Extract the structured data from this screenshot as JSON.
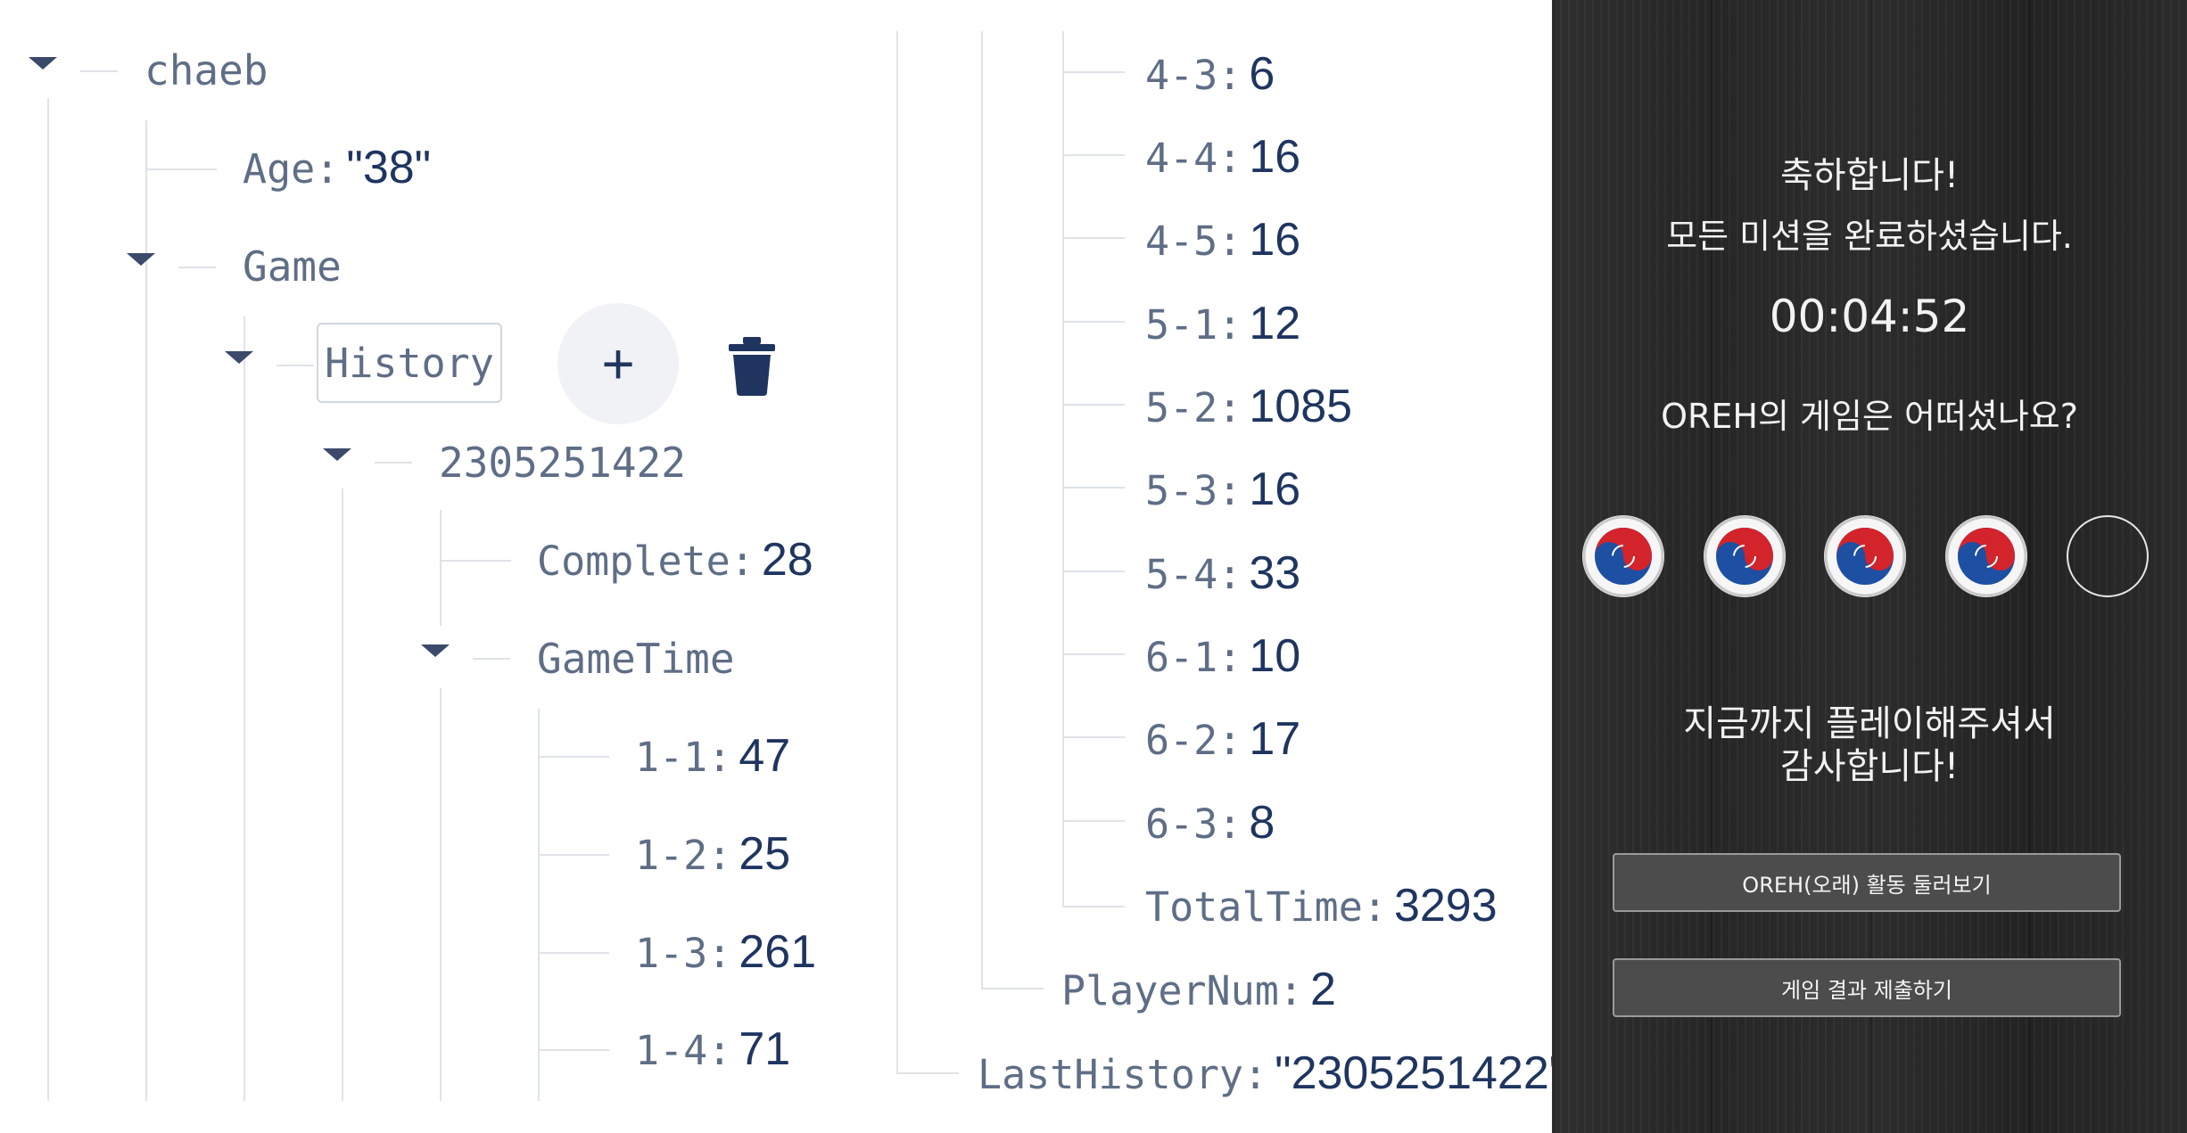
{
  "tree": {
    "root_key": "chaeb",
    "age": {
      "key": "Age",
      "value": "\"38\""
    },
    "game_key": "Game",
    "history_key": "History",
    "add_symbol": "+",
    "session_key": "2305251422",
    "complete": {
      "key": "Complete",
      "value": "28"
    },
    "gametime_key": "GameTime",
    "gametime_left": [
      {
        "key": "1-1",
        "value": "47"
      },
      {
        "key": "1-2",
        "value": "25"
      },
      {
        "key": "1-3",
        "value": "261"
      },
      {
        "key": "1-4",
        "value": "71"
      }
    ],
    "gametime_right": [
      {
        "key": "4-3",
        "value": "6"
      },
      {
        "key": "4-4",
        "value": "16"
      },
      {
        "key": "4-5",
        "value": "16"
      },
      {
        "key": "5-1",
        "value": "12"
      },
      {
        "key": "5-2",
        "value": "1085"
      },
      {
        "key": "5-3",
        "value": "16"
      },
      {
        "key": "5-4",
        "value": "33"
      },
      {
        "key": "6-1",
        "value": "10"
      },
      {
        "key": "6-2",
        "value": "17"
      },
      {
        "key": "6-3",
        "value": "8"
      },
      {
        "key": "TotalTime",
        "value": "3293"
      }
    ],
    "player_num": {
      "key": "PlayerNum",
      "value": "2"
    },
    "last_history": {
      "key": "LastHistory",
      "value": "\"2305251422\""
    }
  },
  "game_panel": {
    "congrats": "축하합니다!",
    "missions_done": "모든 미션을 완료하셨습니다.",
    "elapsed_time": "00:04:52",
    "question": "OREH의 게임은 어떠셨나요?",
    "rating": {
      "filled": 4,
      "total": 5,
      "icon": "taegeuk-medal-icon"
    },
    "thanks_line1": "지금까지 플레이해주셔서",
    "thanks_line2": "감사합니다!",
    "button_activities": "OREH(오래) 활동 둘러보기",
    "button_submit": "게임 결과 제출하기"
  }
}
